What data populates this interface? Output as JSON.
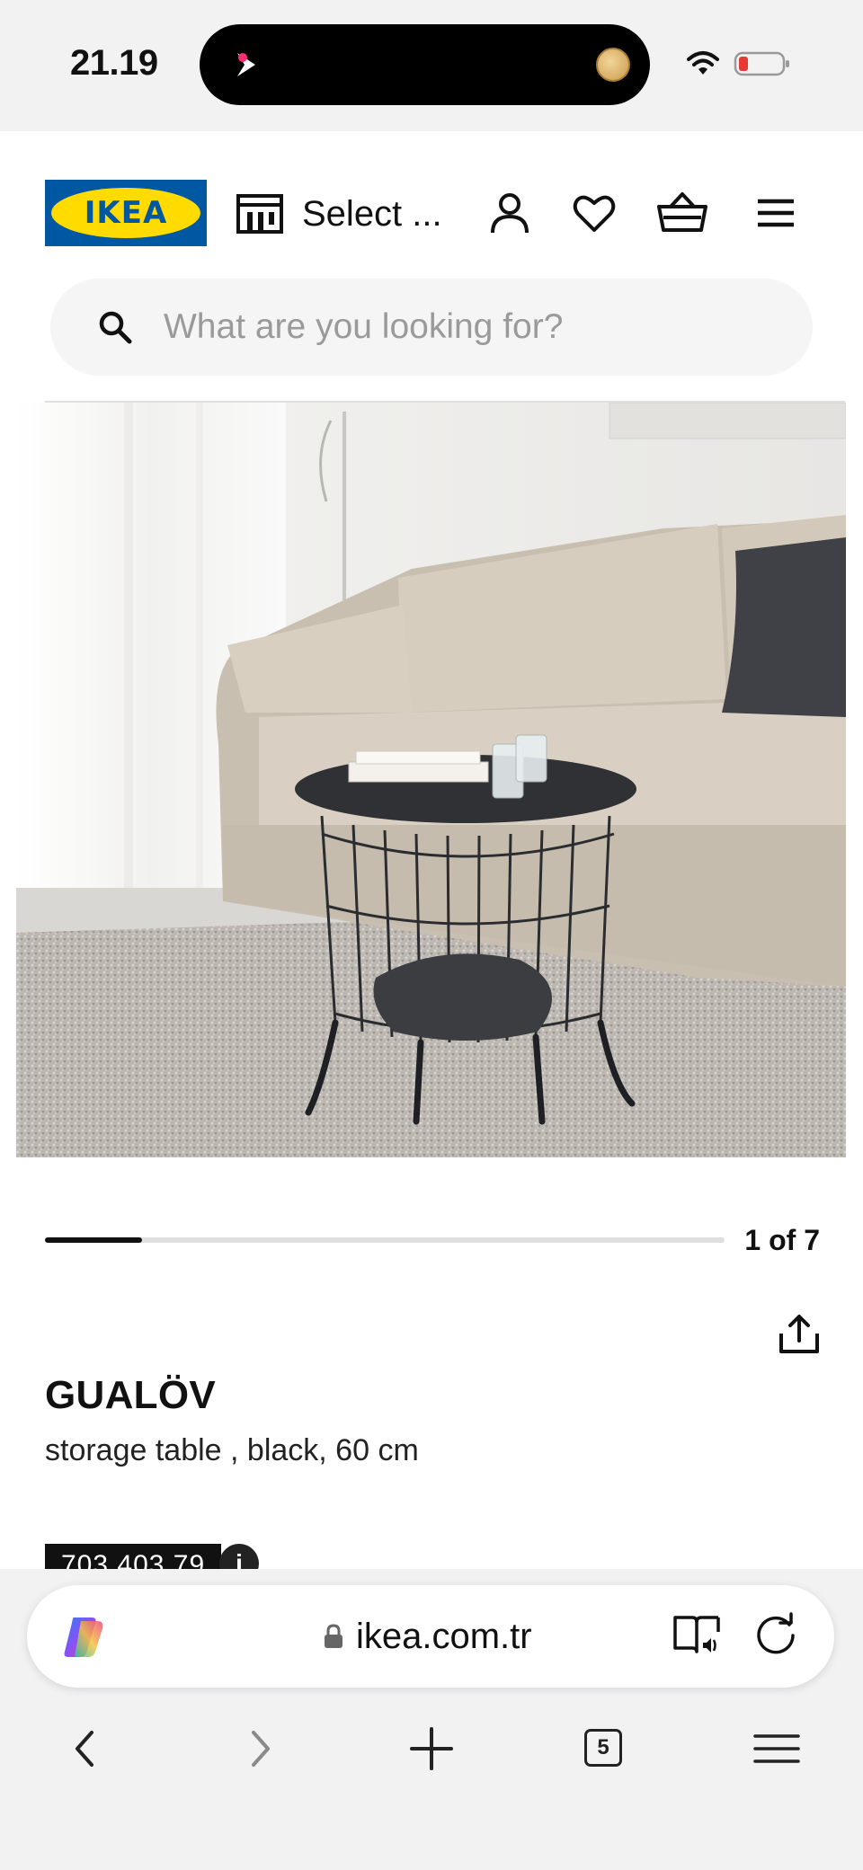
{
  "status_bar": {
    "time": "21.19",
    "battery_color": "#e53935"
  },
  "header": {
    "logo_text": "IKEA",
    "store_label": "Select ...",
    "icons": [
      "store-icon",
      "user-icon",
      "heart-icon",
      "basket-icon",
      "menu-icon"
    ],
    "brand_colors": {
      "blue": "#0058a3",
      "yellow": "#ffdb00"
    }
  },
  "search": {
    "placeholder": "What are you looking for?",
    "value": ""
  },
  "product": {
    "image_alt": "GUALÖV storage table in black beside a beige sofa on a grey rug",
    "carousel": {
      "current": 1,
      "total": 7,
      "counter_text": "1 of 7"
    },
    "name": "GUALÖV",
    "description": "storage table , black, 60 cm",
    "article_number": "703.403.79",
    "info_label": "i"
  },
  "browser": {
    "url": "ikea.com.tr",
    "tab_count": "5",
    "toolbar": [
      "back",
      "forward",
      "new-tab",
      "tabs",
      "menu"
    ]
  }
}
